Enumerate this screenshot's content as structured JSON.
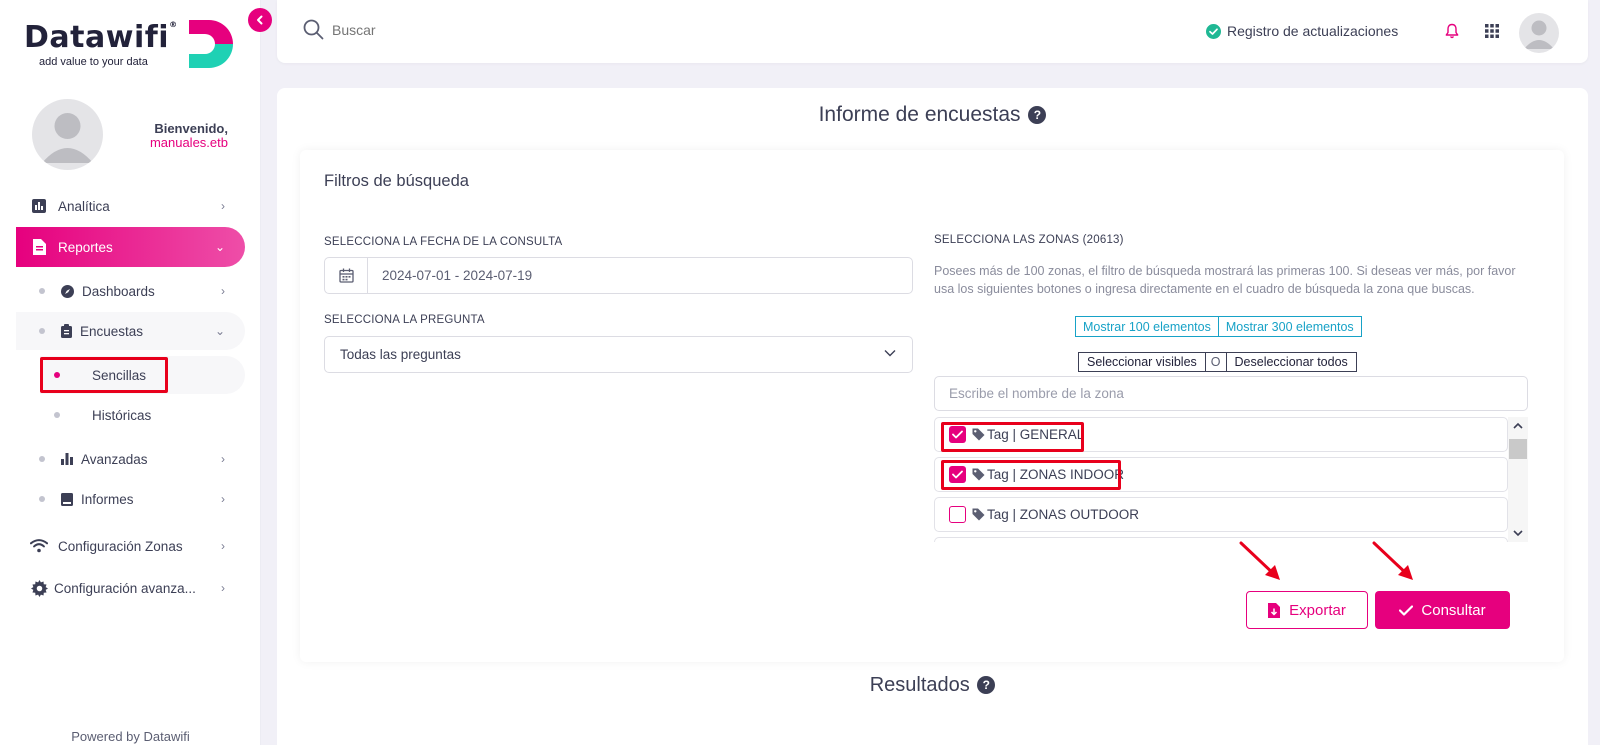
{
  "brand": {
    "name": "Datawifi",
    "tagline": "add value to your data",
    "colors": {
      "primary": "#e6007e",
      "teal": "#1fd1b4",
      "text": "#3c3f55"
    }
  },
  "user": {
    "welcome": "Bienvenido,",
    "username": "manuales.etb"
  },
  "sidebar": {
    "items": [
      {
        "label": "Analítica",
        "icon": "bar-chart-icon"
      },
      {
        "label": "Reportes",
        "icon": "document-icon"
      },
      {
        "label": "Dashboards",
        "icon": "compass-icon"
      },
      {
        "label": "Encuestas",
        "icon": "clipboard-icon"
      },
      {
        "label": "Sencillas"
      },
      {
        "label": "Históricas"
      },
      {
        "label": "Avanzadas",
        "icon": "bar-chart-icon"
      },
      {
        "label": "Informes",
        "icon": "book-icon"
      },
      {
        "label": "Configuración Zonas",
        "icon": "wifi-icon"
      },
      {
        "label": "Configuración avanza...",
        "icon": "gear-icon"
      }
    ],
    "powered": "Powered by Datawifi"
  },
  "header": {
    "search_placeholder": "Buscar",
    "updates_label": "Registro de actualizaciones"
  },
  "main": {
    "title": "Informe de encuestas",
    "filters": {
      "title": "Filtros de búsqueda",
      "date_label": "SELECCIONA LA FECHA DE LA CONSULTA",
      "date_value": "2024-07-01 - 2024-07-19",
      "question_label": "SELECCIONA LA PREGUNTA",
      "question_value": "Todas las preguntas",
      "zones_label": "SELECCIONA LAS ZONAS (20613)",
      "zones_help": "Posees más de 100 zonas, el filtro de búsqueda mostrará las primeras 100. Si deseas ver más, por favor usa los siguientes botones o ingresa directamente en el cuadro de búsqueda la zona que buscas.",
      "show_100": "Mostrar 100 elementos",
      "show_300": "Mostrar 300 elementos",
      "select_visible": "Seleccionar visibles",
      "or": "O",
      "deselect_all": "Deseleccionar todos",
      "zone_search_placeholder": "Escribe el nombre de la zona",
      "zones": [
        {
          "label": "Tag | GENERAL",
          "checked": true
        },
        {
          "label": "Tag | ZONAS INDOOR",
          "checked": true
        },
        {
          "label": "Tag | ZONAS OUTDOOR",
          "checked": false
        }
      ],
      "export_label": "Exportar",
      "submit_label": "Consultar"
    },
    "results_title": "Resultados"
  }
}
